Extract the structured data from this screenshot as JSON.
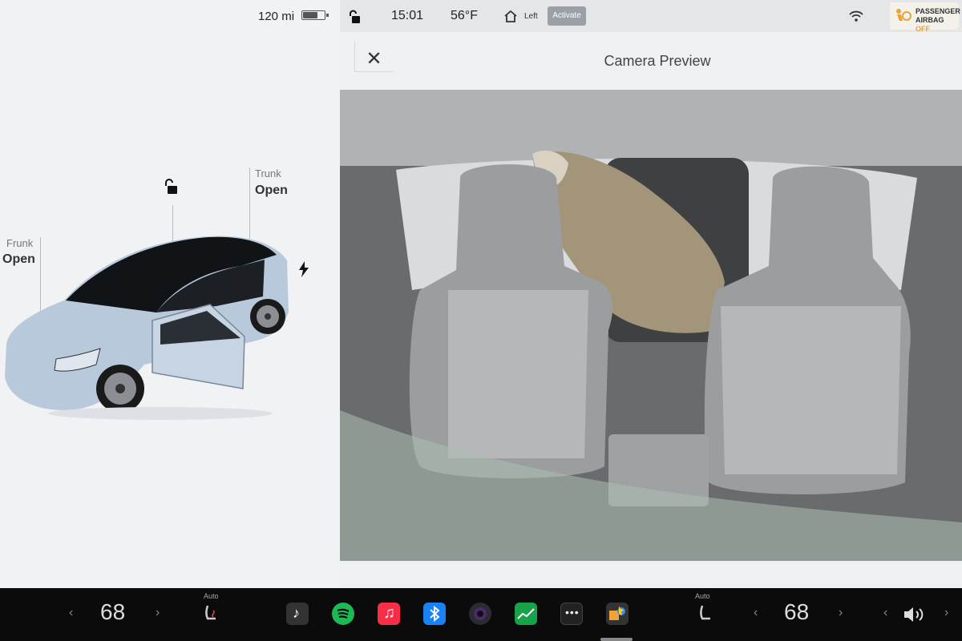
{
  "left_panel": {
    "range": "120 mi",
    "battery_level": 0.7,
    "frunk_label": "Frunk",
    "frunk_status": "Open",
    "trunk_label": "Trunk",
    "trunk_status": "Open",
    "lock_icon": "unlocked-icon",
    "charge_icon": "bolt-icon"
  },
  "status_bar": {
    "lock_icon": "unlocked-icon",
    "time": "15:01",
    "temperature": "56°F",
    "homelink_label": "Left",
    "activate_label": "Activate",
    "wifi_icon": "wifi-icon",
    "airbag_line1": "PASSENGER",
    "airbag_line2": "AIRBAG",
    "airbag_state": "OFF"
  },
  "camera": {
    "title": "Camera Preview",
    "close_icon": "close-icon"
  },
  "dock": {
    "driver_temp": "68",
    "passenger_temp": "68",
    "driver_seat_mode": "Auto",
    "passenger_seat_mode": "Auto",
    "apps": [
      "music",
      "spotify",
      "apple-music",
      "bluetooth",
      "camera",
      "stocks",
      "more",
      "arcade"
    ]
  },
  "colors": {
    "spotify": "#1db954",
    "apple_music": "#fa2d48",
    "bluetooth": "#1a82f7",
    "stocks": "#18a34a",
    "airbag_off": "#e8a33a"
  }
}
